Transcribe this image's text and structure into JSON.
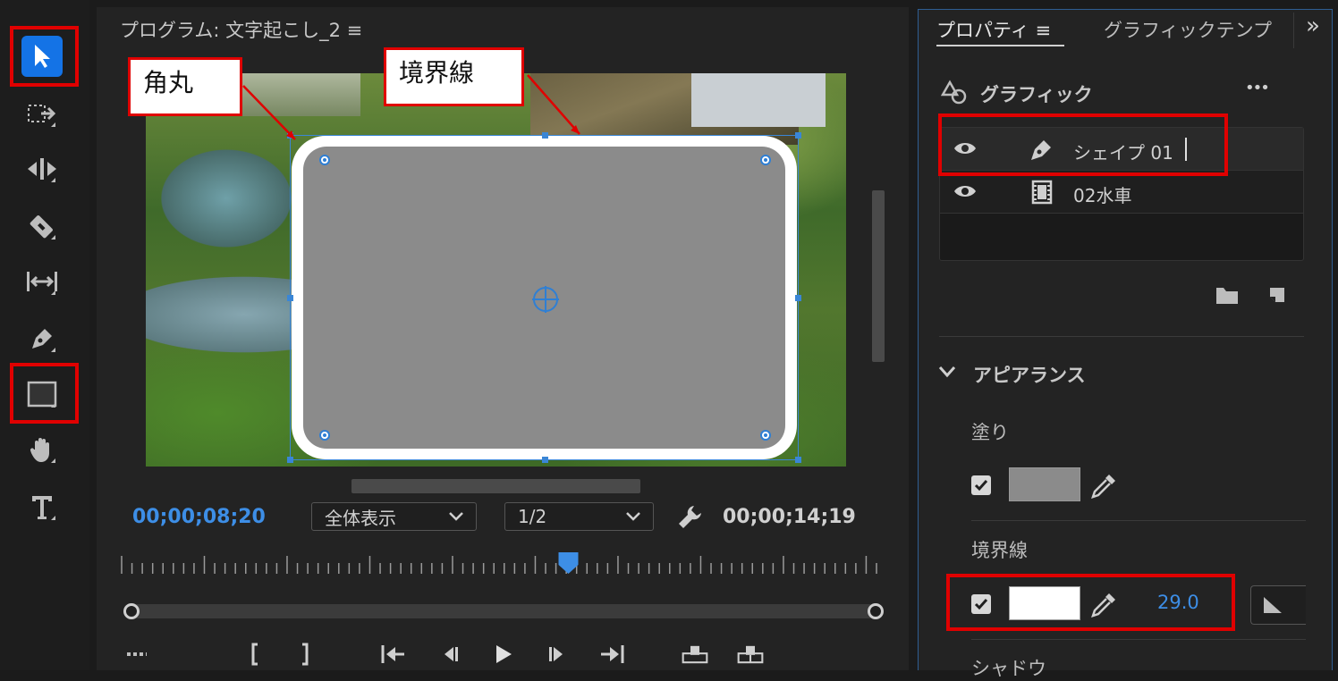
{
  "monitor": {
    "title": "プログラム: 文字起こし_2",
    "menu_glyph": "≡",
    "timecode_current": "00;00;08;20",
    "timecode_duration": "00;00;14;19",
    "zoom_select": "全体表示",
    "resolution_select": "1/2"
  },
  "annotations": {
    "corner_label": "角丸",
    "stroke_label": "境界線"
  },
  "panel": {
    "tab_properties": "プロパティ",
    "tab_menu_glyph": "≡",
    "tab_graphic_template": "グラフィックテンプ",
    "overflow_glyph": "»",
    "graphic_header": "グラフィック",
    "more_glyph": "•••",
    "layers": [
      {
        "name": "シェイプ 01",
        "icon": "pen-icon"
      },
      {
        "name": "02水車",
        "icon": "film-icon"
      }
    ],
    "appearance_header": "アピアランス",
    "fill_label": "塗り",
    "stroke_label": "境界線",
    "stroke_width": "29.0",
    "shadow_label": "シャドウ"
  },
  "colors": {
    "accent_blue": "#3d8ee6",
    "highlight_red": "#e00000",
    "fill_gray": "#8b8b8b",
    "stroke_white": "#ffffff"
  },
  "playhead_fraction": 0.59
}
